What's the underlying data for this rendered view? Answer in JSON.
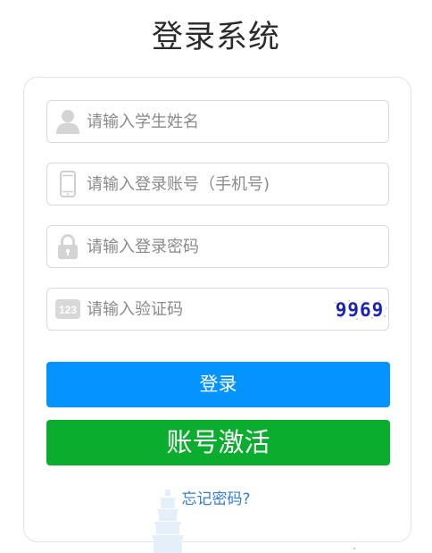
{
  "page": {
    "title": "登录系统"
  },
  "form": {
    "name_placeholder": "请输入学生姓名",
    "phone_placeholder": "请输入登录账号（手机号)",
    "password_placeholder": "请输入登录密码",
    "captcha_placeholder": "请输入验证码",
    "captcha_code": "9969",
    "captcha_icon_text": "123"
  },
  "icons": {
    "name_field": "user-icon",
    "phone_field": "mobile-phone-icon",
    "password_field": "lock-icon",
    "captcha_field": "number-123-icon",
    "background_watermark": "pagoda-watermark-icon"
  },
  "buttons": {
    "login_label": "登录",
    "activate_label": "账号激活"
  },
  "links": {
    "forgot_password": "忘记密码?"
  },
  "colors": {
    "login_button": "#0593ff",
    "activate_button": "#0bad2e",
    "link": "#2f7dd6",
    "captcha_text": "#1a23b8",
    "icon_gray": "#d4d4d4",
    "border": "#d9d9d9",
    "watermark": "#e4effa"
  }
}
